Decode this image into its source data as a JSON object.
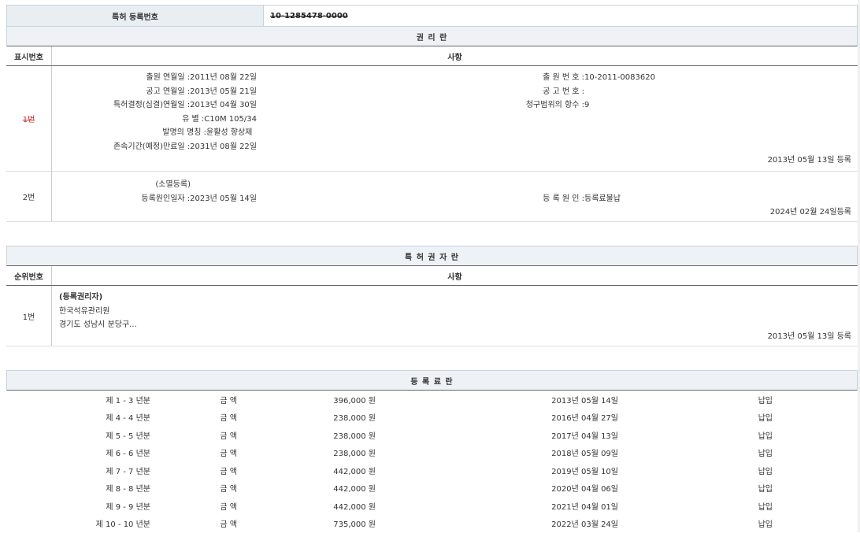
{
  "header": {
    "label": "특허 등록번호",
    "value": "10-1285478-0000"
  },
  "rights": {
    "title": "권 리 란",
    "col_num": "표시번호",
    "col_content": "사항",
    "entry1": {
      "num": "1번",
      "left": [
        {
          "k": "출원 연월일 : ",
          "v": "2011년 08월 22일"
        },
        {
          "k": "공고 연월일 : ",
          "v": "2013년 05월 21일"
        },
        {
          "k": "특허결정(심결)연월일 : ",
          "v": "2013년 04월 30일"
        },
        {
          "k": "유 별 : ",
          "v": "C10M 105/34"
        },
        {
          "k": "발명의 명칭 : ",
          "v": "윤활성 향상제"
        },
        {
          "k": "존속기간(예정)만료일 : ",
          "v": "2031년 08월 22일"
        }
      ],
      "right": [
        {
          "k": "출 원 번 호 : ",
          "v": "10-2011-0083620"
        },
        {
          "k": "공 고 번 호 : ",
          "v": ""
        },
        {
          "k": "청구범위의 항수 : ",
          "v": "9"
        }
      ],
      "reg": "2013년 05월 13일 등록"
    },
    "entry2": {
      "num": "2번",
      "type": "(소멸등록)",
      "left_k": "등록원인일자 : ",
      "left_v": "2023년 05월 14일",
      "right_k": "등 록 원 인 : ",
      "right_v": "등록료불납",
      "reg": "2024년 02월 24일등록"
    }
  },
  "holders": {
    "title": "특 허 권 자 란",
    "col_num": "순위번호",
    "col_content": "사항",
    "entry": {
      "num": "1번",
      "type": "(등록권리자)",
      "name": "한국석유관리원",
      "address": "경기도 성남시 분당구...",
      "reg": "2013년 05월 13일 등록"
    }
  },
  "fees": {
    "title": "등 록 료 란",
    "rows": [
      {
        "year": "제 1 - 3 년분",
        "label": "금 액",
        "amount": "396,000 원",
        "date": "2013년 05월 14일",
        "status": "납입"
      },
      {
        "year": "제 4 - 4 년분",
        "label": "금 액",
        "amount": "238,000 원",
        "date": "2016년 04월 27일",
        "status": "납입"
      },
      {
        "year": "제 5 - 5 년분",
        "label": "금 액",
        "amount": "238,000 원",
        "date": "2017년 04월 13일",
        "status": "납입"
      },
      {
        "year": "제 6 - 6 년분",
        "label": "금 액",
        "amount": "238,000 원",
        "date": "2018년 05월 09일",
        "status": "납입"
      },
      {
        "year": "제 7 - 7 년분",
        "label": "금 액",
        "amount": "442,000 원",
        "date": "2019년 05월 10일",
        "status": "납입"
      },
      {
        "year": "제 8 - 8 년분",
        "label": "금 액",
        "amount": "442,000 원",
        "date": "2020년 04월 06일",
        "status": "납입"
      },
      {
        "year": "제 9 - 9 년분",
        "label": "금 액",
        "amount": "442,000 원",
        "date": "2021년 04월 01일",
        "status": "납입"
      },
      {
        "year": "제 10 - 10 년분",
        "label": "금 액",
        "amount": "735,000 원",
        "date": "2022년 03월 24일",
        "status": "납입"
      }
    ]
  }
}
